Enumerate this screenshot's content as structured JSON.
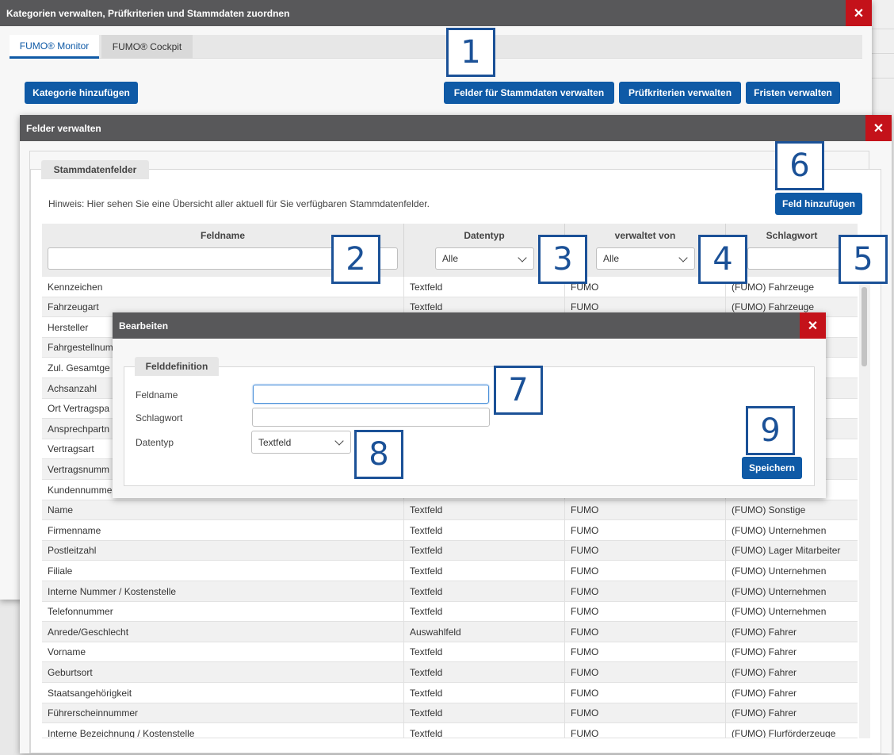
{
  "outer_dialog": {
    "title": "Kategorien verwalten, Prüfkriterien und Stammdaten zuordnen",
    "close_glyph": "✕",
    "tabs": [
      {
        "label": "FUMO® Monitor",
        "active": true
      },
      {
        "label": "FUMO® Cockpit",
        "active": false
      }
    ],
    "buttons": {
      "add_category": "Kategorie hinzufügen",
      "manage_master_fields": "Felder für Stammdaten verwalten",
      "manage_criteria": "Prüfkriterien verwalten",
      "manage_deadlines": "Fristen verwalten"
    }
  },
  "fields_dialog": {
    "title": "Felder verwalten",
    "close_glyph": "✕",
    "section_legend": "Stammdatenfelder",
    "hint": "Hinweis: Hier sehen Sie eine Übersicht aller aktuell für Sie verfügbaren Stammdatenfelder.",
    "add_field_button": "Feld hinzufügen",
    "columns": {
      "name": "Feldname",
      "type": "Datentyp",
      "managed_by": "verwaltet von",
      "keyword": "Schlagwort"
    },
    "filters": {
      "name_value": "",
      "type_selected": "Alle",
      "managed_by_selected": "Alle",
      "keyword_value": ""
    },
    "rows": [
      {
        "name": "Kennzeichen",
        "type": "Textfeld",
        "managed_by": "FUMO",
        "keyword": "(FUMO) Fahrzeuge"
      },
      {
        "name": "Fahrzeugart",
        "type": "Textfeld",
        "managed_by": "FUMO",
        "keyword": "(FUMO) Fahrzeuge"
      },
      {
        "name": "Hersteller",
        "type": "",
        "managed_by": "",
        "keyword": ""
      },
      {
        "name": "Fahrgestellnum",
        "type": "",
        "managed_by": "",
        "keyword": ""
      },
      {
        "name": "Zul. Gesamtge",
        "type": "",
        "managed_by": "",
        "keyword": ""
      },
      {
        "name": "Achsanzahl",
        "type": "",
        "managed_by": "",
        "keyword": ""
      },
      {
        "name": "Ort Vertragspa",
        "type": "",
        "managed_by": "",
        "keyword": ""
      },
      {
        "name": "Ansprechpartn",
        "type": "",
        "managed_by": "",
        "keyword": ""
      },
      {
        "name": "Vertragsart",
        "type": "",
        "managed_by": "",
        "keyword": ""
      },
      {
        "name": "Vertragsnumm",
        "type": "",
        "managed_by": "",
        "keyword": ""
      },
      {
        "name": "Kundennumme",
        "type": "",
        "managed_by": "",
        "keyword": ""
      },
      {
        "name": "Name",
        "type": "Textfeld",
        "managed_by": "FUMO",
        "keyword": "(FUMO) Sonstige"
      },
      {
        "name": "Firmenname",
        "type": "Textfeld",
        "managed_by": "FUMO",
        "keyword": "(FUMO) Unternehmen"
      },
      {
        "name": "Postleitzahl",
        "type": "Textfeld",
        "managed_by": "FUMO",
        "keyword": "(FUMO) Lager Mitarbeiter"
      },
      {
        "name": "Filiale",
        "type": "Textfeld",
        "managed_by": "FUMO",
        "keyword": "(FUMO) Unternehmen"
      },
      {
        "name": "Interne Nummer / Kostenstelle",
        "type": "Textfeld",
        "managed_by": "FUMO",
        "keyword": "(FUMO) Unternehmen"
      },
      {
        "name": "Telefonnummer",
        "type": "Textfeld",
        "managed_by": "FUMO",
        "keyword": "(FUMO) Unternehmen"
      },
      {
        "name": "Anrede/Geschlecht",
        "type": "Auswahlfeld",
        "managed_by": "FUMO",
        "keyword": "(FUMO) Fahrer"
      },
      {
        "name": "Vorname",
        "type": "Textfeld",
        "managed_by": "FUMO",
        "keyword": "(FUMO) Fahrer"
      },
      {
        "name": "Geburtsort",
        "type": "Textfeld",
        "managed_by": "FUMO",
        "keyword": "(FUMO) Fahrer"
      },
      {
        "name": "Staatsangehörigkeit",
        "type": "Textfeld",
        "managed_by": "FUMO",
        "keyword": "(FUMO) Fahrer"
      },
      {
        "name": "Führerscheinnummer",
        "type": "Textfeld",
        "managed_by": "FUMO",
        "keyword": "(FUMO) Fahrer"
      },
      {
        "name": "Interne Bezeichnung / Kostenstelle",
        "type": "Textfeld",
        "managed_by": "FUMO",
        "keyword": "(FUMO) Flurförderzeuge"
      }
    ]
  },
  "edit_dialog": {
    "title": "Bearbeiten",
    "close_glyph": "✕",
    "section_legend": "Felddefinition",
    "labels": {
      "field_name": "Feldname",
      "keyword": "Schlagwort",
      "data_type": "Datentyp"
    },
    "values": {
      "field_name": "",
      "keyword": "",
      "data_type": "Textfeld"
    },
    "save_button": "Speichern"
  },
  "callouts": [
    "1",
    "2",
    "3",
    "4",
    "5",
    "6",
    "7",
    "8",
    "9"
  ],
  "colors": {
    "titlebar": "#58585a",
    "close": "#c4121a",
    "primary": "#0f5aa6",
    "callout": "#1b5197"
  }
}
